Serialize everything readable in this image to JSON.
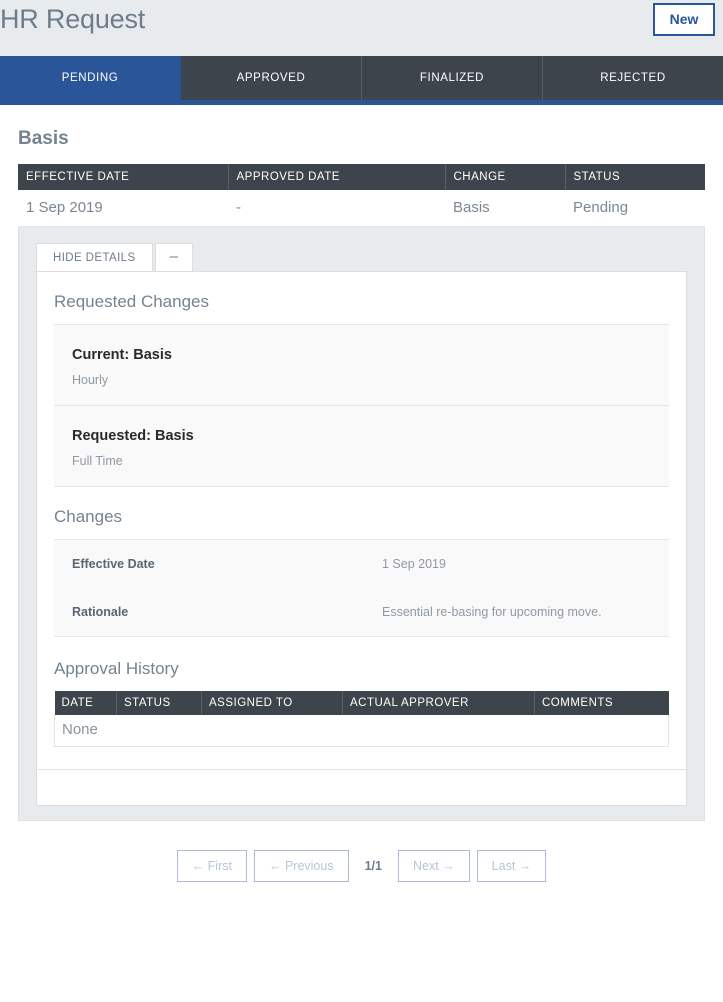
{
  "header": {
    "title": "HR Request",
    "new_label": "New",
    "accent_color": "#2a5699",
    "bar_color": "#e8ebed"
  },
  "tabs": [
    {
      "label": "PENDING",
      "active": true
    },
    {
      "label": "APPROVED",
      "active": false
    },
    {
      "label": "FINALIZED",
      "active": false
    },
    {
      "label": "REJECTED",
      "active": false
    }
  ],
  "section": {
    "title": "Basis"
  },
  "request_table": {
    "columns": [
      "EFFECTIVE DATE",
      "APPROVED DATE",
      "CHANGE",
      "STATUS"
    ],
    "rows": [
      {
        "effective_date": "1 Sep 2019",
        "approved_date": "-",
        "change": "Basis",
        "status": "Pending"
      }
    ]
  },
  "detail": {
    "tabs": {
      "hide_details": "HIDE DETAILS",
      "collapse": "–"
    },
    "requested_changes": {
      "title": "Requested Changes",
      "blocks": [
        {
          "key": "Current: Basis",
          "value": "Hourly"
        },
        {
          "key": "Requested: Basis",
          "value": "Full Time"
        }
      ]
    },
    "changes": {
      "title": "Changes",
      "rows": [
        {
          "label": "Effective Date",
          "value": "1 Sep 2019"
        },
        {
          "label": "Rationale",
          "value": "Essential re-basing for upcoming move."
        }
      ]
    },
    "approval_history": {
      "title": "Approval History",
      "columns": [
        "DATE",
        "STATUS",
        "ASSIGNED TO",
        "ACTUAL APPROVER",
        "COMMENTS"
      ],
      "empty_text": "None"
    }
  },
  "pagination": {
    "first": "← First",
    "previous": "← Previous",
    "indicator": "1/1",
    "next": "Next →",
    "last": "Last →"
  }
}
